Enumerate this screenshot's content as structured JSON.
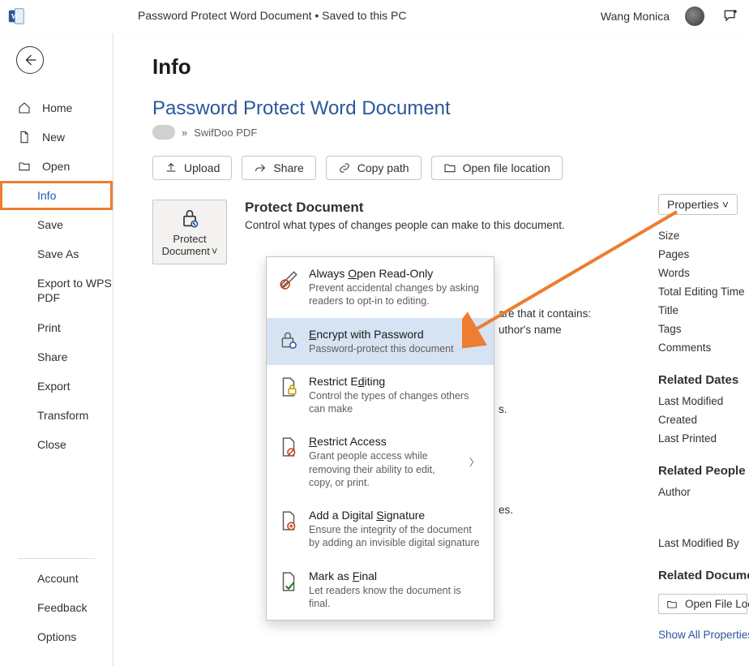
{
  "app": {
    "title_raw": "Password Protect Word Document • Saved to this PC",
    "user": "Wang Monica"
  },
  "sidebar": {
    "home": "Home",
    "new": "New",
    "open": "Open",
    "info": "Info",
    "save": "Save",
    "saveas": "Save As",
    "exportwps": "Export to WPS PDF",
    "print": "Print",
    "share": "Share",
    "export": "Export",
    "transform": "Transform",
    "close": "Close",
    "account": "Account",
    "feedback": "Feedback",
    "options": "Options"
  },
  "content": {
    "page_heading": "Info",
    "doc_title": "Password Protect Word Document",
    "path_sep": "»",
    "path_folder": "SwifDoo PDF",
    "actions": {
      "upload": "Upload",
      "share": "Share",
      "copy": "Copy path",
      "openloc": "Open file location"
    },
    "protect_tile_line1": "Protect",
    "protect_tile_line2": "Document",
    "protect_head": "Protect Document",
    "protect_sub": "Control what types of changes people can make to this document.",
    "behind1": "are that it contains:",
    "behind2": "uthor's name",
    "behind3": "s.",
    "behind4": "es."
  },
  "dropdown": {
    "readonly_t": "Always Open Read-Only",
    "readonly_d": "Prevent accidental changes by asking readers to opt-in to editing.",
    "encrypt_t": "Encrypt with Password",
    "encrypt_d": "Password-protect this document",
    "restrict_t": "Restrict Editing",
    "restrict_d": "Control the types of changes others can make",
    "access_t": "Restrict Access",
    "access_d": "Grant people access while removing their ability to edit, copy, or print.",
    "sig_t": "Add a Digital Signature",
    "sig_d": "Ensure the integrity of the document by adding an invisible digital signature",
    "final_t": "Mark as Final",
    "final_d": "Let readers know the document is final."
  },
  "props": {
    "btn": "Properties",
    "size": "Size",
    "pages": "Pages",
    "words": "Words",
    "editing": "Total Editing Time",
    "title": "Title",
    "tags": "Tags",
    "comments": "Comments",
    "related_dates": "Related Dates",
    "last_mod": "Last Modified",
    "created": "Created",
    "last_print": "Last Printed",
    "related_people": "Related People",
    "author": "Author",
    "last_mod_by": "Last Modified By",
    "related_docs": "Related Documen",
    "open_file_loc": "Open File Loca",
    "show_all": "Show All Properties"
  }
}
